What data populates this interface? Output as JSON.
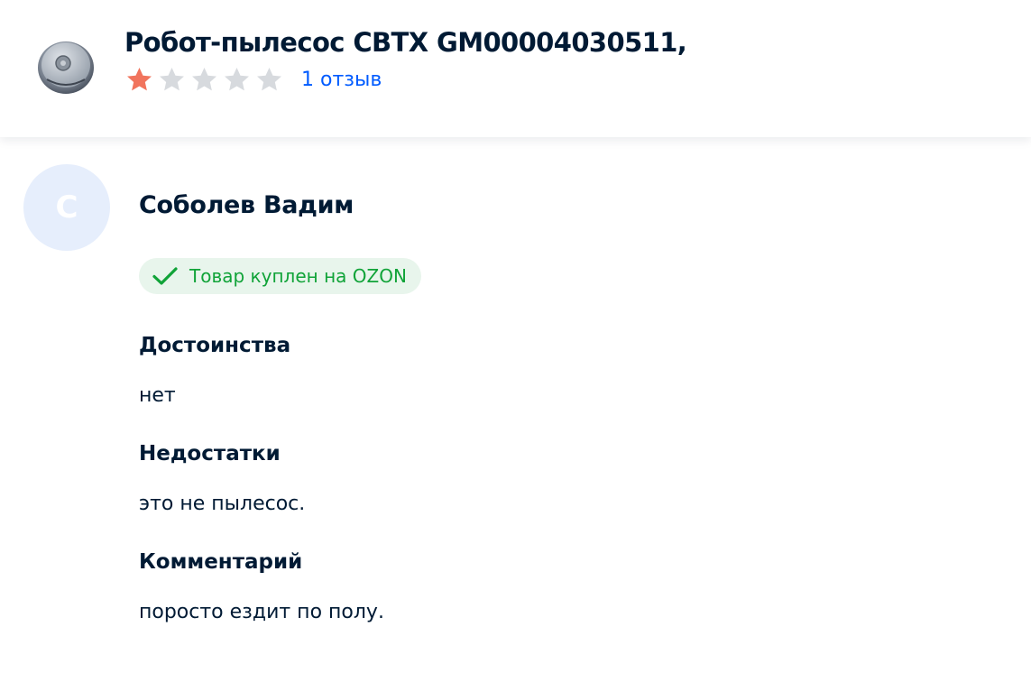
{
  "product": {
    "title": "Робот-пылесос CBTX GM00004030511,",
    "thumbnail_icon": "robot-vacuum-icon",
    "rating": 1,
    "rating_max": 5,
    "review_count_label": "1 отзыв"
  },
  "review": {
    "author_initial": "С",
    "author_name": "Соболев Вадим",
    "badge": {
      "icon": "checkmark-icon",
      "label": "Товар куплен на OZON"
    },
    "sections": [
      {
        "title": "Достоинства",
        "text": "нет"
      },
      {
        "title": "Недостатки",
        "text": "это не пылесос."
      },
      {
        "title": "Комментарий",
        "text": "поросто ездит по полу."
      }
    ]
  },
  "colors": {
    "star_filled": "#f1745d",
    "star_empty": "#d7dade",
    "link": "#005bff",
    "badge_bg": "#e8f5ec",
    "badge_text": "#10a338",
    "avatar_bg": "#e6eefc",
    "text_primary": "#001a34"
  }
}
